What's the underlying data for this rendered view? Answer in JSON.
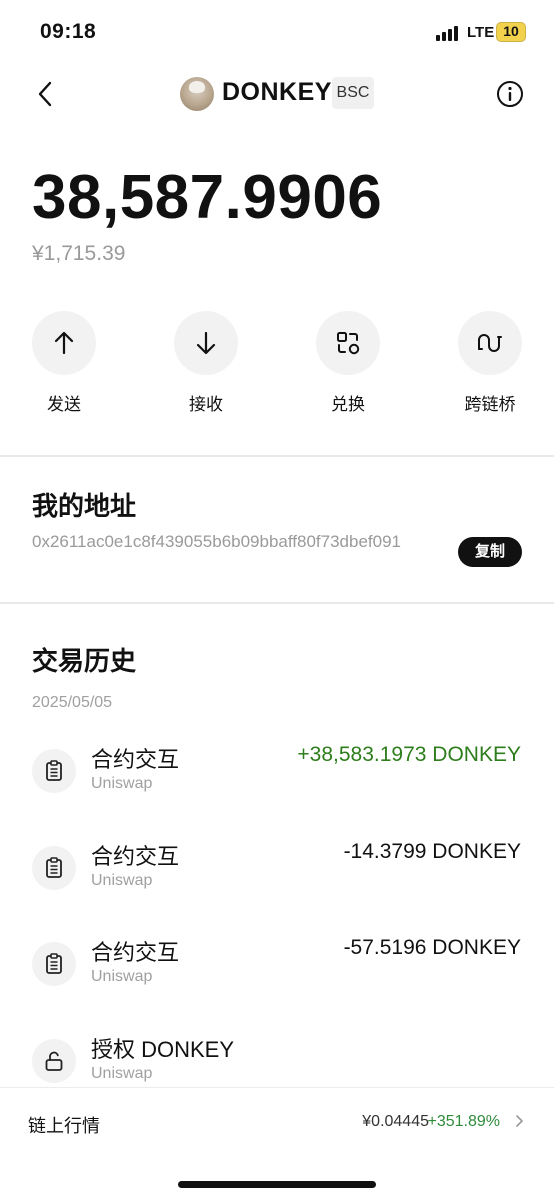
{
  "status_bar": {
    "time": "09:18",
    "network": "LTE",
    "battery": "10"
  },
  "header": {
    "token_name": "DONKEY",
    "chain": "BSC"
  },
  "balance": {
    "amount": "38,587.9906",
    "fiat": "¥1,715.39"
  },
  "actions": [
    {
      "label": "发送",
      "icon": "arrow-up-icon"
    },
    {
      "label": "接收",
      "icon": "arrow-down-icon"
    },
    {
      "label": "兑换",
      "icon": "swap-icon"
    },
    {
      "label": "跨链桥",
      "icon": "bridge-icon"
    }
  ],
  "address": {
    "title": "我的地址",
    "value": "0x2611ac0e1c8f439055b6b09bbaff80f73dbef091",
    "copy_label": "复制"
  },
  "history": {
    "title": "交易历史",
    "date": "2025/05/05",
    "items": [
      {
        "title": "合约交互",
        "subtitle": "Uniswap",
        "amount": "+38,583.1973 DONKEY",
        "icon": "contract-icon"
      },
      {
        "title": "合约交互",
        "subtitle": "Uniswap",
        "amount": "-14.3799 DONKEY",
        "icon": "contract-icon"
      },
      {
        "title": "合约交互",
        "subtitle": "Uniswap",
        "amount": "-57.5196 DONKEY",
        "icon": "contract-icon"
      },
      {
        "title": "授权 DONKEY",
        "subtitle": "Uniswap",
        "amount": "",
        "icon": "unlock-icon"
      }
    ]
  },
  "market": {
    "label": "链上行情",
    "price": "¥0.04445",
    "change": "+351.89%"
  },
  "colors": {
    "positive": "#2e7d1c",
    "market_positive": "#2e8b3a",
    "battery": "#f2d24c"
  }
}
